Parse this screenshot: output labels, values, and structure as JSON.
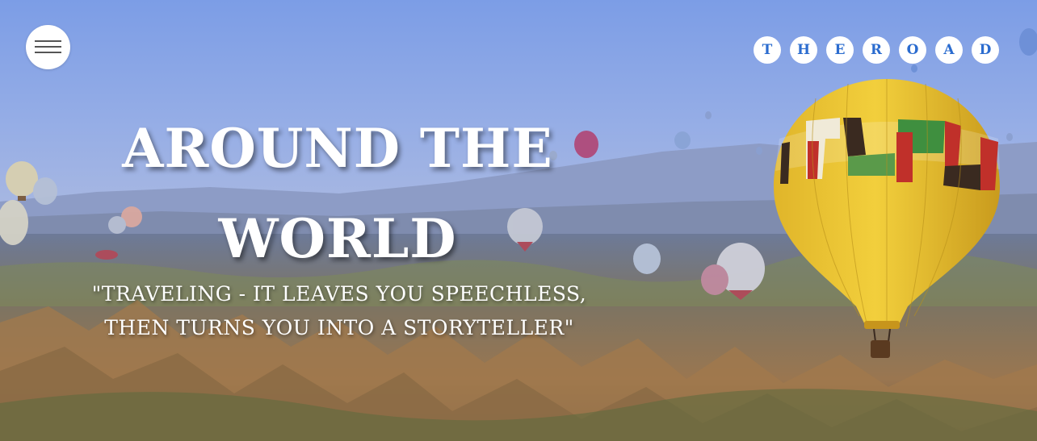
{
  "nav": {
    "menu_icon": "hamburger-icon"
  },
  "logo": {
    "letters": [
      "T",
      "H",
      "E",
      "R",
      "O",
      "A",
      "D"
    ],
    "color": "#2b6ccf"
  },
  "hero": {
    "title_line1": "AROUND THE",
    "title_line2": "WORLD",
    "quote_line1": "\"TRAVELING - IT LEAVES YOU SPEECHLESS,",
    "quote_line2": "THEN TURNS YOU INTO A STORYTELLER\"",
    "background": "hot-air-balloons-landscape-photo"
  }
}
